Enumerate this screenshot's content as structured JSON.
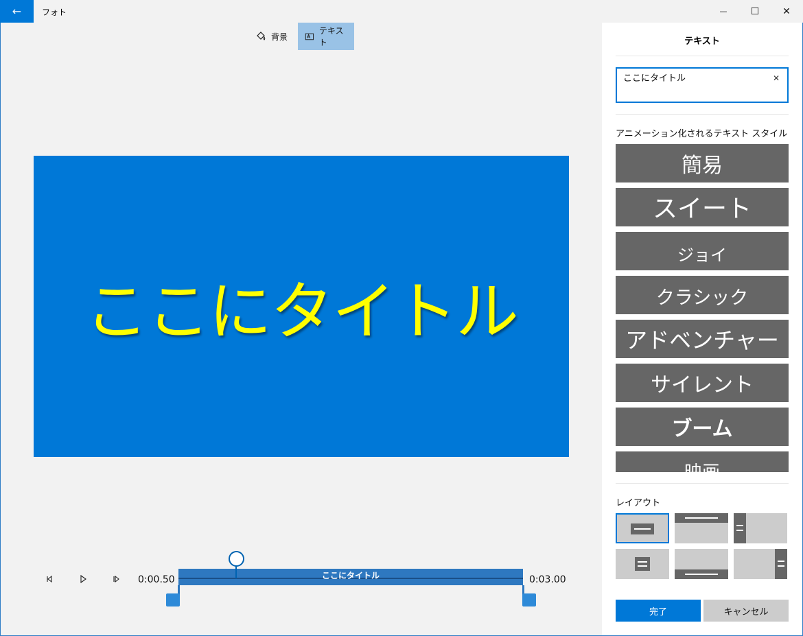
{
  "titlebar": {
    "back_icon": "←",
    "app_title": "フォト",
    "minimize_icon": "—",
    "maximize_icon": "☐",
    "close_icon": "✕"
  },
  "toolbar": {
    "background_label": "背景",
    "background_icon": "paint-bucket-icon",
    "text_label": "テキスト",
    "text_icon": "text-box-icon"
  },
  "preview": {
    "title_text": "ここにタイトル",
    "background_color": "#0078d7",
    "text_color": "#ffff00"
  },
  "playback": {
    "prev_frame_icon": "◁|",
    "play_icon": "▷",
    "next_frame_icon": "|▷",
    "time_start": "0:00.50",
    "time_end": "0:03.00"
  },
  "timeline": {
    "clip_label": "ここにタイトル"
  },
  "panel": {
    "title": "テキスト",
    "text_input_value": "ここにタイトル",
    "clear_icon": "✕",
    "styles_label": "アニメーション化されるテキスト スタイル",
    "styles": [
      {
        "label": "簡易"
      },
      {
        "label": "スイート"
      },
      {
        "label": "ジョイ"
      },
      {
        "label": "クラシック"
      },
      {
        "label": "アドベンチャー"
      },
      {
        "label": "サイレント"
      },
      {
        "label": "ブーム"
      },
      {
        "label": "映画"
      }
    ],
    "layout_label": "レイアウト",
    "done_label": "完了",
    "cancel_label": "キャンセル"
  }
}
